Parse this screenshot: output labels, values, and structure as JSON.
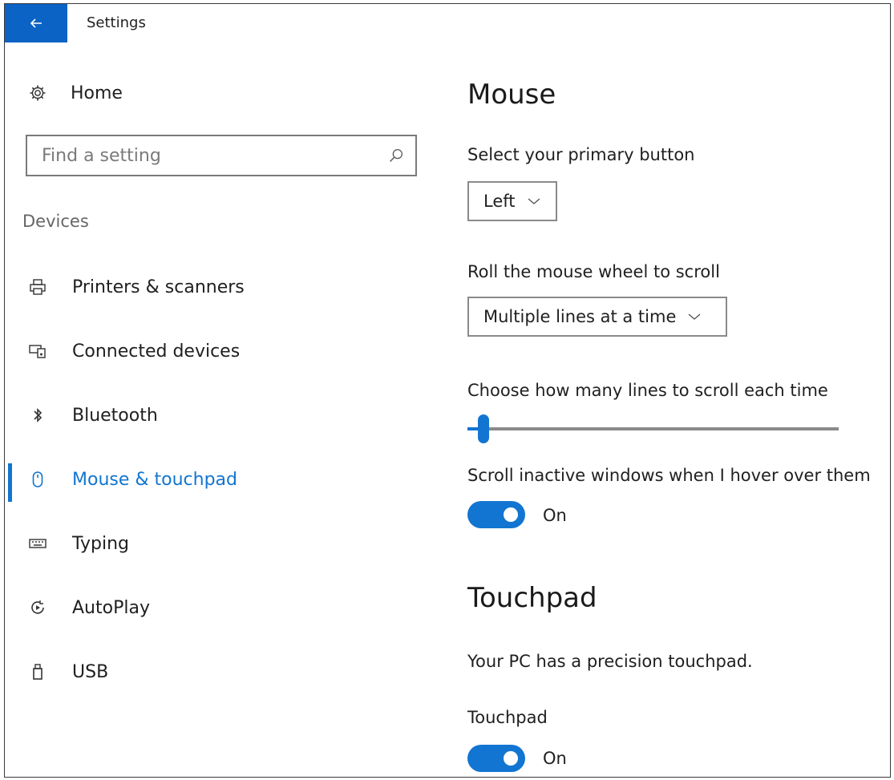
{
  "window": {
    "title": "Settings"
  },
  "sidebar": {
    "home_label": "Home",
    "search_placeholder": "Find a setting",
    "section_label": "Devices",
    "items": [
      {
        "label": "Printers & scanners",
        "icon": "printer-icon"
      },
      {
        "label": "Connected devices",
        "icon": "connected-devices-icon"
      },
      {
        "label": "Bluetooth",
        "icon": "bluetooth-icon"
      },
      {
        "label": "Mouse & touchpad",
        "icon": "mouse-icon",
        "active": true
      },
      {
        "label": "Typing",
        "icon": "keyboard-icon"
      },
      {
        "label": "AutoPlay",
        "icon": "autoplay-icon"
      },
      {
        "label": "USB",
        "icon": "usb-icon"
      }
    ]
  },
  "mouse": {
    "heading": "Mouse",
    "primary_button_label": "Select your primary button",
    "primary_button_value": "Left",
    "wheel_label": "Roll the mouse wheel to scroll",
    "wheel_value": "Multiple lines at a time",
    "lines_label": "Choose how many lines to scroll each time",
    "lines_slider_fraction": 0.03,
    "inactive_label": "Scroll inactive windows when I hover over them",
    "inactive_toggle": "On"
  },
  "touchpad": {
    "heading": "Touchpad",
    "info": "Your PC has a precision touchpad.",
    "toggle_label": "Touchpad",
    "toggle_value": "On"
  },
  "colors": {
    "accent": "#1275d1",
    "back_button": "#0b63c5"
  }
}
